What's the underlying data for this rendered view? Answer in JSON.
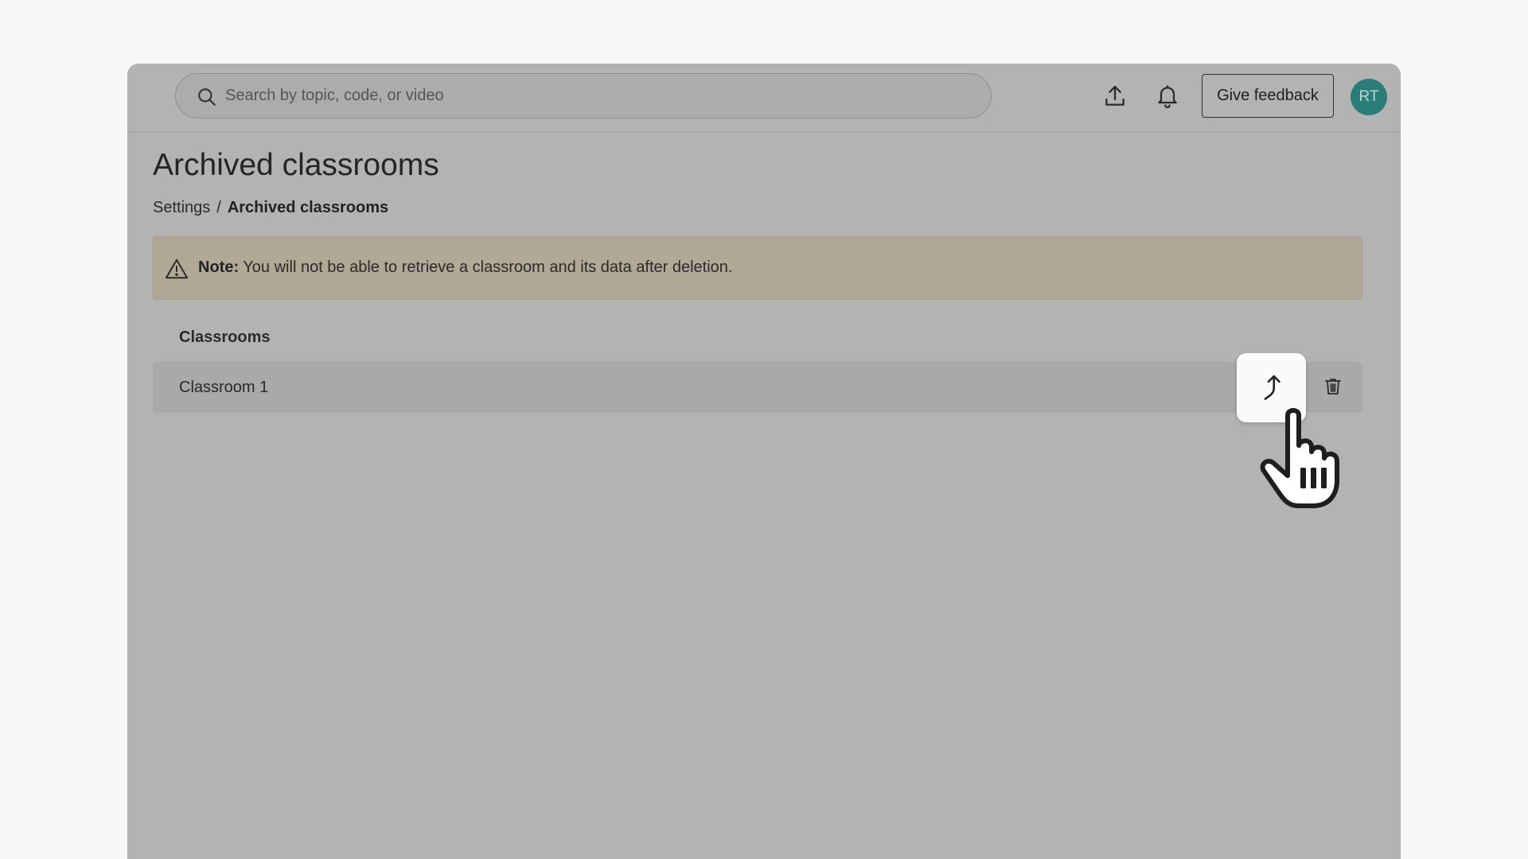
{
  "header": {
    "search": {
      "placeholder": "Search by topic, code, or video"
    },
    "icons": {
      "search": "search-icon",
      "upload": "upload-icon",
      "notifications": "bell-icon"
    },
    "feedback_label": "Give feedback",
    "avatar_initials": "RT",
    "avatar_color": "#2b7d78"
  },
  "page": {
    "title": "Archived classrooms",
    "breadcrumb": {
      "parent": "Settings",
      "separator": "/",
      "current": "Archived classrooms"
    }
  },
  "note": {
    "icon": "warning-icon",
    "label": "Note:",
    "message": " You will not be able to retrieve a classroom and its data after deletion."
  },
  "classrooms": {
    "header": "Classrooms",
    "rows": [
      {
        "name": "Classroom 1",
        "actions": [
          "unarchive-icon",
          "trash-icon"
        ]
      }
    ]
  }
}
